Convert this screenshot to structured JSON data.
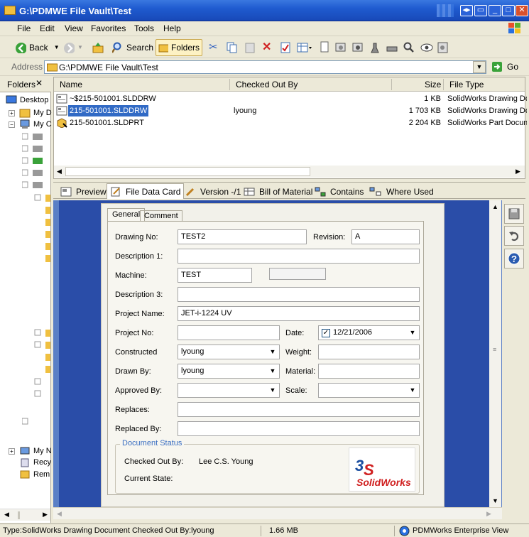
{
  "window": {
    "title": "G:\\PDMWE File Vault\\Test"
  },
  "menu": [
    "File",
    "Edit",
    "View",
    "Favorites",
    "Tools",
    "Help"
  ],
  "toolbar": {
    "back": "Back",
    "search": "Search",
    "folders": "Folders"
  },
  "address": {
    "label": "Address",
    "value": "G:\\PDMWE File Vault\\Test",
    "go": "Go"
  },
  "folders": {
    "title": "Folders",
    "items": [
      "Desktop",
      "My D",
      "My C",
      "My N",
      "Recy",
      "Rem"
    ]
  },
  "filelist": {
    "columns": [
      "Name",
      "Checked Out By",
      "Size",
      "File Type"
    ],
    "rows": [
      {
        "name": "~$215-501001.SLDDRW",
        "checked_out_by": "",
        "size": "1 KB",
        "type": "SolidWorks Drawing Doc"
      },
      {
        "name": "215-501001.SLDDRW",
        "checked_out_by": "lyoung",
        "size": "1 703 KB",
        "type": "SolidWorks Drawing Doc"
      },
      {
        "name": "215-501001.SLDPRT",
        "checked_out_by": "",
        "size": "2 204 KB",
        "type": "SolidWorks Part Docume"
      }
    ]
  },
  "tabs": [
    "Preview",
    "File Data Card",
    "Version -/1",
    "Bill of Material",
    "Contains",
    "Where Used"
  ],
  "card": {
    "tabs": [
      "General",
      "Comment"
    ],
    "labels": {
      "drawing_no": "Drawing No:",
      "revision": "Revision:",
      "description1": "Description 1:",
      "machine": "Machine:",
      "description3": "Description 3:",
      "project_name": "Project Name:",
      "project_no": "Project No:",
      "date": "Date:",
      "constructed": "Constructed",
      "weight": "Weight:",
      "drawn_by": "Drawn By:",
      "material": "Material:",
      "approved_by": "Approved By:",
      "scale": "Scale:",
      "replaces": "Replaces:",
      "replaced_by": "Replaced By:"
    },
    "values": {
      "drawing_no": "TEST2",
      "revision": "A",
      "description1": "",
      "machine": "TEST",
      "description3": "",
      "project_name": "JET-i-1224 UV",
      "project_no": "",
      "date": "12/21/2006",
      "constructed": "lyoung",
      "weight": "",
      "drawn_by": "lyoung",
      "material": "",
      "approved_by": "",
      "scale": "",
      "replaces": "",
      "replaced_by": ""
    },
    "status": {
      "legend": "Document Status",
      "checked_out_label": "Checked Out By:",
      "checked_out_value": "Lee C.S. Young",
      "state_label": "Current State:",
      "state_value": "",
      "logo": "SolidWorks"
    }
  },
  "statusbar": {
    "type": "Type:SolidWorks Drawing Document  Checked Out By:lyoung",
    "size": "1.66 MB",
    "app": "PDMWorks Enterprise View"
  }
}
